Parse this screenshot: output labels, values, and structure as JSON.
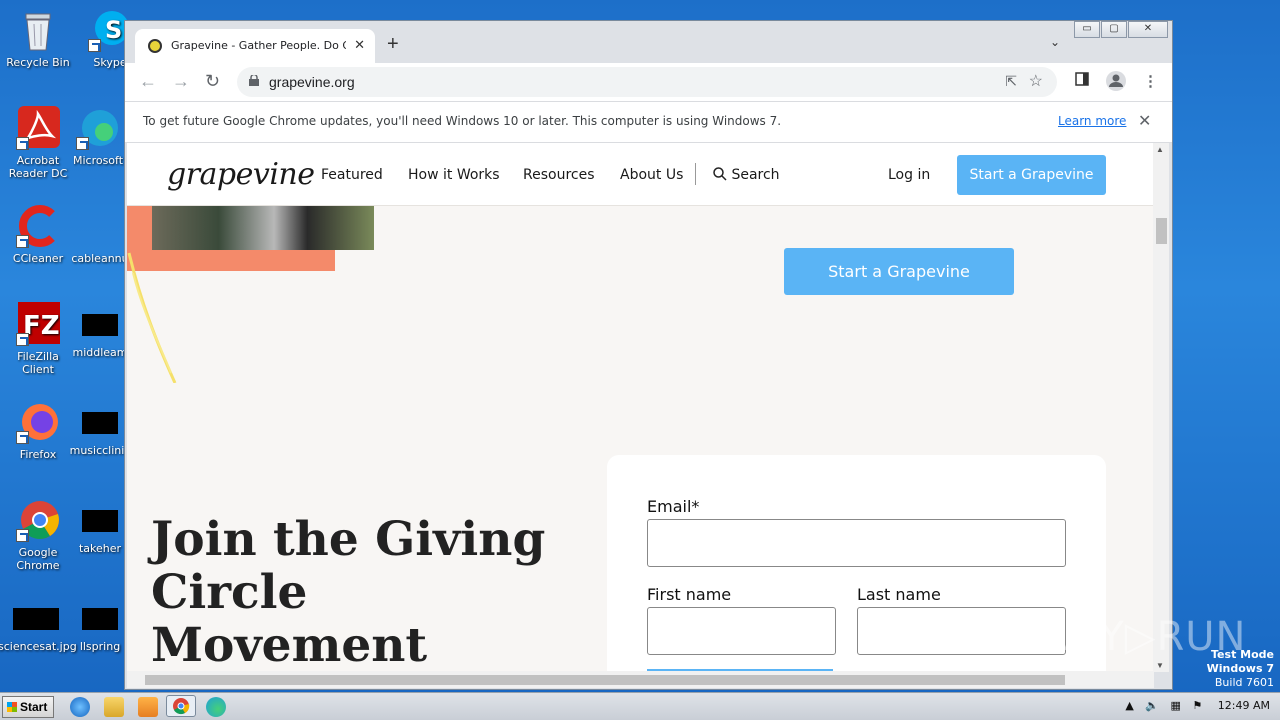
{
  "desktop": {
    "icons": [
      {
        "label": "Recycle Bin"
      },
      {
        "label": "Skype"
      },
      {
        "label": "Acrobat Reader DC"
      },
      {
        "label": "Microsoft"
      },
      {
        "label": "CCleaner"
      },
      {
        "label": "cableannu"
      },
      {
        "label": "FileZilla Client"
      },
      {
        "label": "middleam"
      },
      {
        "label": "Firefox"
      },
      {
        "label": "musicclinic"
      },
      {
        "label": "Google Chrome"
      },
      {
        "label": "takeher"
      },
      {
        "label": "sciencesat.jpg"
      },
      {
        "label": "llspring"
      }
    ]
  },
  "browser": {
    "tab_title": "Grapevine - Gather People. Do Good",
    "tab_close": "✕",
    "new_tab": "+",
    "tab_dropdown": "⌄",
    "url": "grapevine.org",
    "window_buttons": [
      "▭",
      "▢",
      "✕"
    ]
  },
  "infobar": {
    "message": "To get future Google Chrome updates, you'll need Windows 10 or later. This computer is using Windows 7.",
    "link": "Learn more",
    "close": "✕"
  },
  "site": {
    "logo": "grapevine",
    "nav": [
      "Featured",
      "How it Works",
      "Resources",
      "About Us"
    ],
    "search": "Search",
    "login": "Log in",
    "cta_header": "Start a Grapevine",
    "cta_hero": "Start a Grapevine",
    "hero_title": "Join the Giving Circle Movement",
    "form": {
      "email_label": "Email*",
      "first_name_label": "First name",
      "last_name_label": "Last name"
    }
  },
  "taskbar": {
    "start": "Start",
    "clock": "12:49 AM"
  },
  "watermark": {
    "line1": "Test Mode",
    "line2": "Windows 7",
    "line3": "Build 7601",
    "brand": "ANY▷RUN"
  },
  "colors": {
    "cta_blue": "#5ab4f5",
    "coral": "#f48a6a",
    "page_bg": "#f8f6f4"
  }
}
